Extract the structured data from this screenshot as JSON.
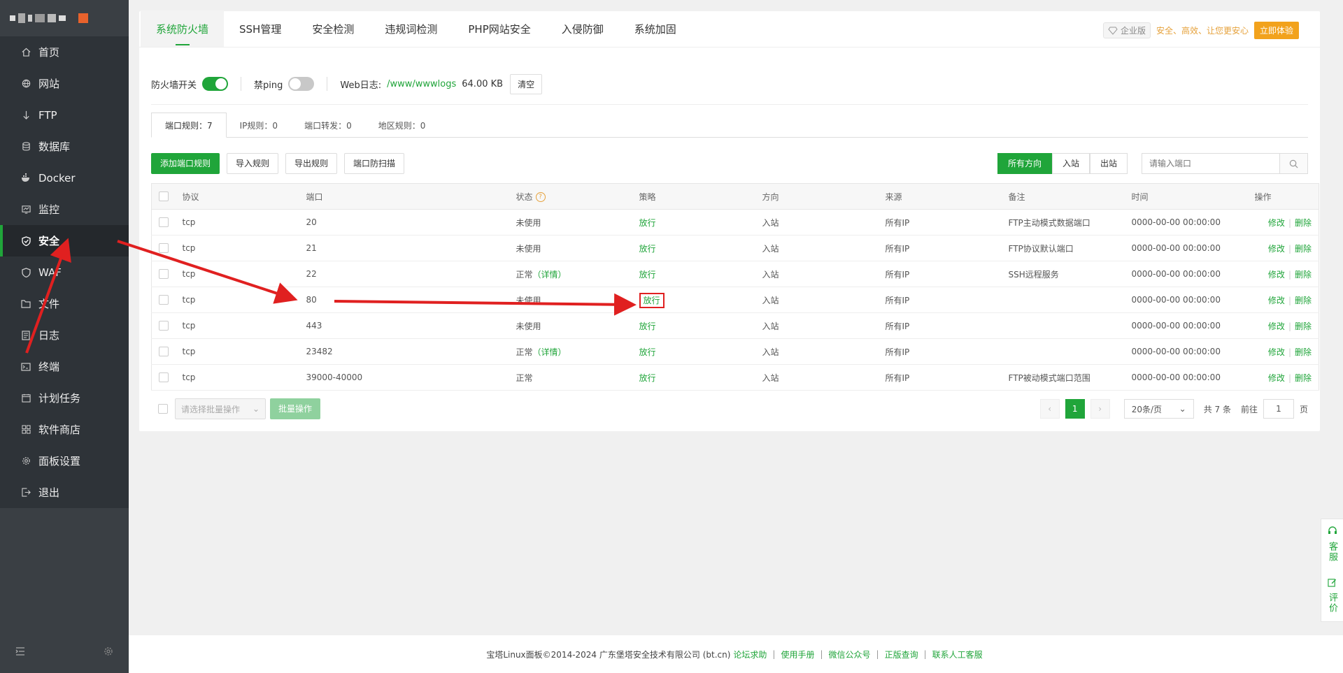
{
  "sidebar": {
    "items": [
      {
        "label": "首页",
        "icon": "home-icon"
      },
      {
        "label": "网站",
        "icon": "globe-icon"
      },
      {
        "label": "FTP",
        "icon": "ftp-icon"
      },
      {
        "label": "数据库",
        "icon": "database-icon"
      },
      {
        "label": "Docker",
        "icon": "docker-icon"
      },
      {
        "label": "监控",
        "icon": "monitor-icon"
      },
      {
        "label": "安全",
        "icon": "shield-icon"
      },
      {
        "label": "WAF",
        "icon": "waf-icon"
      },
      {
        "label": "文件",
        "icon": "folder-icon"
      },
      {
        "label": "日志",
        "icon": "log-icon"
      },
      {
        "label": "终端",
        "icon": "terminal-icon"
      },
      {
        "label": "计划任务",
        "icon": "calendar-icon"
      },
      {
        "label": "软件商店",
        "icon": "store-icon"
      },
      {
        "label": "面板设置",
        "icon": "gear-icon"
      },
      {
        "label": "退出",
        "icon": "logout-icon"
      }
    ]
  },
  "tabs": [
    "系统防火墙",
    "SSH管理",
    "安全检测",
    "违规词检测",
    "PHP网站安全",
    "入侵防御",
    "系统加固"
  ],
  "enterprise": {
    "badge": "企业版",
    "slogan": "安全、高效、让您更安心",
    "button": "立即体验"
  },
  "toolbar": {
    "firewall_label": "防火墙开关",
    "ping_label": "禁ping",
    "weblog_label": "Web日志:",
    "weblog_path": "/www/wwwlogs",
    "weblog_size": "64.00 KB",
    "clear_button": "清空"
  },
  "subtabs": [
    "端口规则：7",
    "IP规则：0",
    "端口转发：0",
    "地区规则：0"
  ],
  "actions": {
    "add": "添加端口规则",
    "import": "导入规则",
    "export": "导出规则",
    "scan": "端口防扫描",
    "dir_all": "所有方向",
    "dir_in": "入站",
    "dir_out": "出站",
    "search_placeholder": "请输入端口"
  },
  "table": {
    "headers": [
      "协议",
      "端口",
      "状态",
      "策略",
      "方向",
      "来源",
      "备注",
      "时间",
      "操作"
    ],
    "rows": [
      {
        "protocol": "tcp",
        "port": "20",
        "status": "未使用",
        "detail": "",
        "policy": "放行",
        "direction": "入站",
        "source": "所有IP",
        "note": "FTP主动模式数据端口",
        "time": "0000-00-00 00:00:00"
      },
      {
        "protocol": "tcp",
        "port": "21",
        "status": "未使用",
        "detail": "",
        "policy": "放行",
        "direction": "入站",
        "source": "所有IP",
        "note": "FTP协议默认端口",
        "time": "0000-00-00 00:00:00"
      },
      {
        "protocol": "tcp",
        "port": "22",
        "status": "正常",
        "detail": "（详情）",
        "policy": "放行",
        "direction": "入站",
        "source": "所有IP",
        "note": "SSH远程服务",
        "time": "0000-00-00 00:00:00"
      },
      {
        "protocol": "tcp",
        "port": "80",
        "status": "未使用",
        "detail": "",
        "policy": "放行",
        "direction": "入站",
        "source": "所有IP",
        "note": "",
        "time": "0000-00-00 00:00:00"
      },
      {
        "protocol": "tcp",
        "port": "443",
        "status": "未使用",
        "detail": "",
        "policy": "放行",
        "direction": "入站",
        "source": "所有IP",
        "note": "",
        "time": "0000-00-00 00:00:00"
      },
      {
        "protocol": "tcp",
        "port": "23482",
        "status": "正常",
        "detail": "（详情）",
        "policy": "放行",
        "direction": "入站",
        "source": "所有IP",
        "note": "",
        "time": "0000-00-00 00:00:00"
      },
      {
        "protocol": "tcp",
        "port": "39000-40000",
        "status": "正常",
        "detail": "",
        "policy": "放行",
        "direction": "入站",
        "source": "所有IP",
        "note": "FTP被动模式端口范围",
        "time": "0000-00-00 00:00:00"
      }
    ],
    "op_edit": "修改",
    "op_delete": "删除"
  },
  "batch": {
    "select_placeholder": "请选择批量操作",
    "button": "批量操作"
  },
  "pager": {
    "current": "1",
    "page_size": "20条/页",
    "total": "共 7 条",
    "goto_prefix": "前往",
    "goto_value": "1",
    "goto_suffix": "页"
  },
  "footer": {
    "copyright": "宝塔Linux面板©2014-2024 广东堡塔安全技术有限公司 (bt.cn)",
    "links": [
      "论坛求助",
      "使用手册",
      "微信公众号",
      "正版查询",
      "联系人工客服"
    ]
  },
  "float": {
    "service": "客服",
    "review": "评价"
  },
  "colors": {
    "accent": "#20a53a",
    "sidebar": "#3a3f44",
    "annotation": "#e02020",
    "gold": "#f2a21c"
  }
}
